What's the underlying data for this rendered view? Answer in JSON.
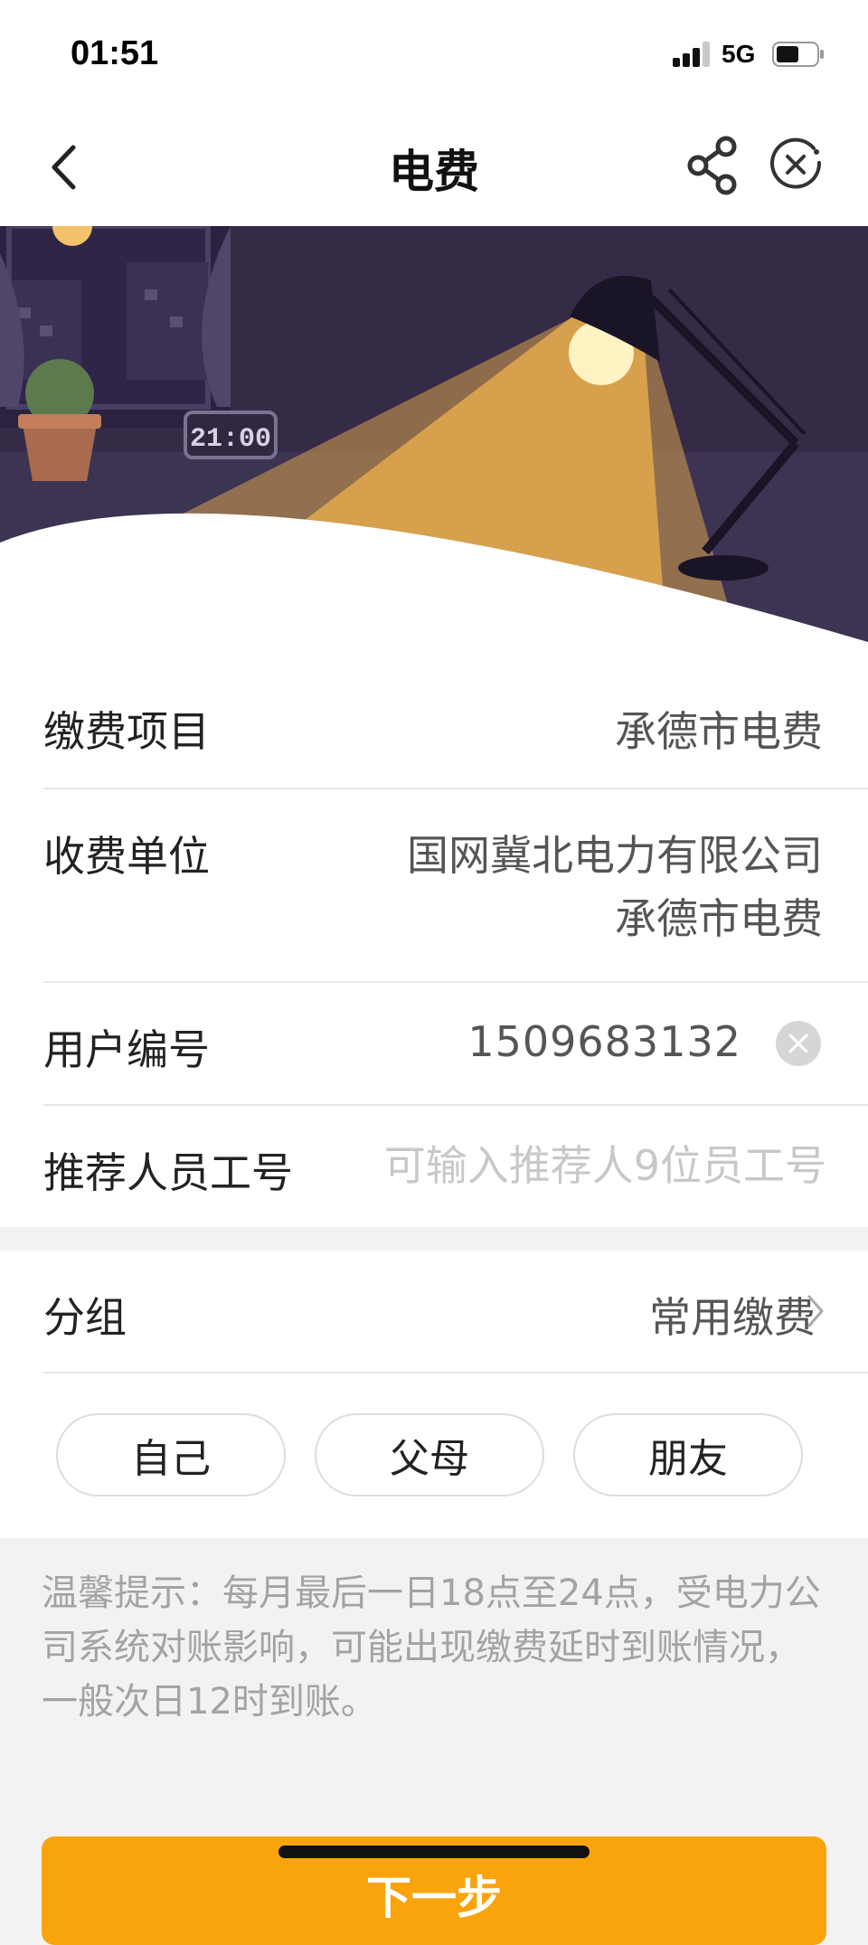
{
  "status_bar": {
    "time": "01:51",
    "network": "5G"
  },
  "nav": {
    "title": "电费"
  },
  "banner": {
    "clock_text": "21:00"
  },
  "form": {
    "item": {
      "label": "缴费项目",
      "value": "承德市电费"
    },
    "unit": {
      "label": "收费单位",
      "value_line1": "国网冀北电力有限公司",
      "value_line2": "承德市电费"
    },
    "user_no": {
      "label": "用户编号",
      "value": "1509683132"
    },
    "referrer": {
      "label": "推荐人员工号",
      "placeholder": "可输入推荐人9位员工号"
    }
  },
  "group": {
    "label": "分组",
    "value": "常用缴费",
    "chips": [
      "自己",
      "父母",
      "朋友"
    ]
  },
  "tip": {
    "text": "温馨提示：每月最后一日18点至24点，受电力公司系统对账影响，可能出现缴费延时到账情况，一般次日12时到账。"
  },
  "next_button": {
    "label": "下一步"
  },
  "colors": {
    "accent": "#f9a40c",
    "banner_bg": "#352b47",
    "light_beam": "#d7a04c"
  },
  "icons": [
    "back-arrow-icon",
    "share-icon",
    "close-circle-icon",
    "clear-icon",
    "chevron-right-icon"
  ]
}
